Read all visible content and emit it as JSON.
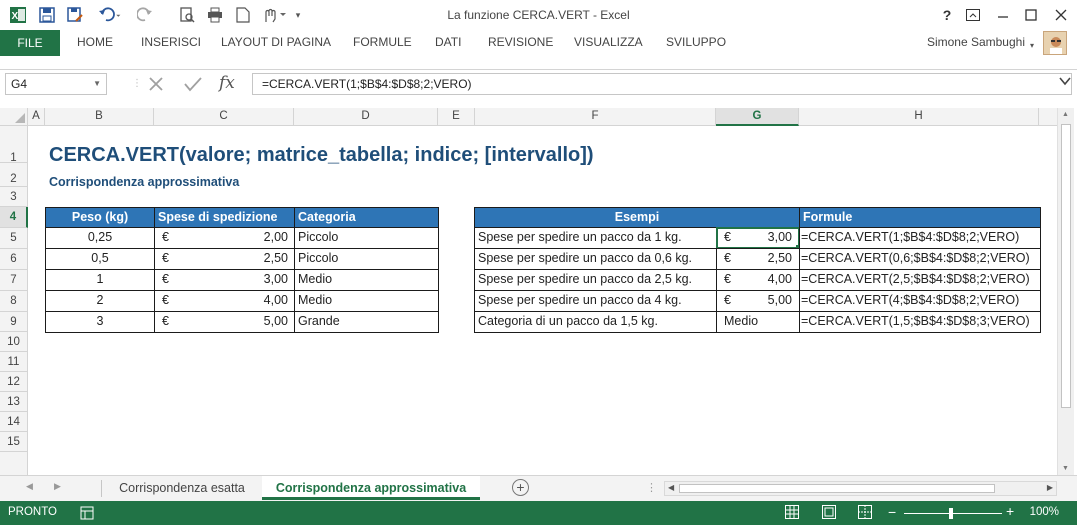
{
  "window": {
    "title": "La funzione CERCA.VERT - Excel"
  },
  "ribbon": {
    "file_label": "FILE",
    "tabs": [
      "HOME",
      "INSERISCI",
      "LAYOUT DI PAGINA",
      "FORMULE",
      "DATI",
      "REVISIONE",
      "VISUALIZZA",
      "SVILUPPO"
    ],
    "user_name": "Simone Sambughi"
  },
  "formula_bar": {
    "name_box": "G4",
    "formula": "=CERCA.VERT(1;$B$4:$D$8;2;VERO)"
  },
  "columns": [
    "A",
    "B",
    "C",
    "D",
    "E",
    "F",
    "G",
    "H"
  ],
  "selected_column": "G",
  "rows": [
    "1",
    "2",
    "3",
    "4",
    "5",
    "6",
    "7",
    "8",
    "9",
    "10",
    "11",
    "12",
    "13",
    "14",
    "15"
  ],
  "selected_row": "4",
  "sheet": {
    "title": "CERCA.VERT(valore; matrice_tabella; indice; [intervallo])",
    "subtitle": "Corrispondenza approssimativa",
    "lookup_table": {
      "headers": [
        "Peso (kg)",
        "Spese di spedizione",
        "Categoria"
      ],
      "rows": [
        {
          "peso": "0,25",
          "currency": "€",
          "spese": "2,00",
          "categoria": "Piccolo"
        },
        {
          "peso": "0,5",
          "currency": "€",
          "spese": "2,50",
          "categoria": "Piccolo"
        },
        {
          "peso": "1",
          "currency": "€",
          "spese": "3,00",
          "categoria": "Medio"
        },
        {
          "peso": "2",
          "currency": "€",
          "spese": "4,00",
          "categoria": "Medio"
        },
        {
          "peso": "3",
          "currency": "€",
          "spese": "5,00",
          "categoria": "Grande"
        }
      ]
    },
    "examples_table": {
      "headers": [
        "Esempi",
        "Formule"
      ],
      "rows": [
        {
          "desc": "Spese per spedire un pacco da 1 kg.",
          "currency": "€",
          "value": "3,00",
          "formula": "=CERCA.VERT(1;$B$4:$D$8;2;VERO)"
        },
        {
          "desc": "Spese per spedire un pacco da 0,6 kg.",
          "currency": "€",
          "value": "2,50",
          "formula": "=CERCA.VERT(0,6;$B$4:$D$8;2;VERO)"
        },
        {
          "desc": "Spese per spedire un pacco da 2,5 kg.",
          "currency": "€",
          "value": "4,00",
          "formula": "=CERCA.VERT(2,5;$B$4:$D$8;2;VERO)"
        },
        {
          "desc": "Spese per spedire un pacco da 4 kg.",
          "currency": "€",
          "value": "5,00",
          "formula": "=CERCA.VERT(4;$B$4:$D$8;2;VERO)"
        },
        {
          "desc": "Categoria di un pacco da 1,5 kg.",
          "currency": "",
          "value": "Medio",
          "formula": "=CERCA.VERT(1,5;$B$4:$D$8;3;VERO)"
        }
      ]
    }
  },
  "sheet_tabs": [
    "Corrispondenza esatta",
    "Corrispondenza approssimativa"
  ],
  "active_sheet": "Corrispondenza approssimativa",
  "status": {
    "text": "PRONTO",
    "zoom": "100%"
  },
  "colors": {
    "excel_green": "#217346",
    "header_blue": "#2e75b6",
    "title_blue": "#1f4e79"
  }
}
